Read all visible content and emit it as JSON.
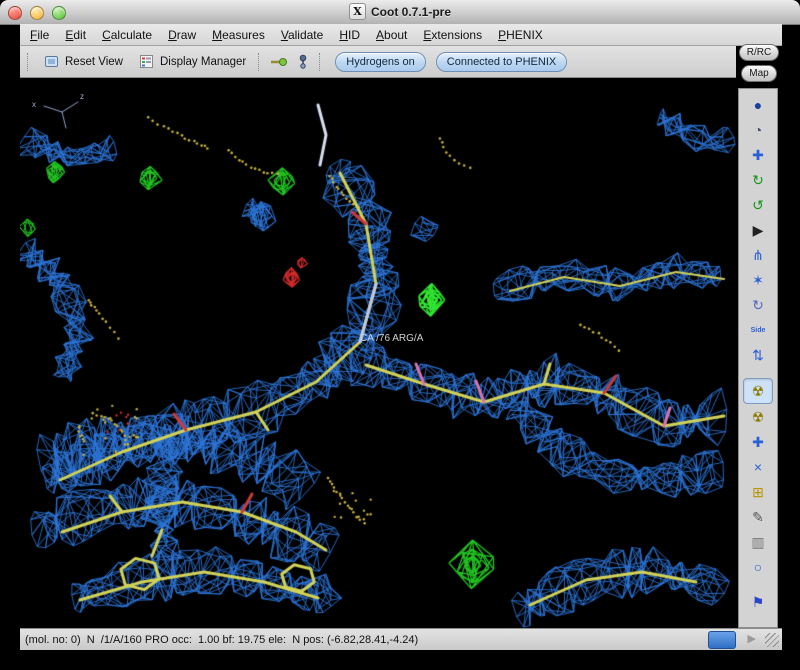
{
  "window": {
    "title": "Coot 0.7.1-pre",
    "icon_glyph": "X"
  },
  "menu": {
    "items": [
      {
        "label": "File"
      },
      {
        "label": "Edit"
      },
      {
        "label": "Calculate"
      },
      {
        "label": "Draw"
      },
      {
        "label": "Measures"
      },
      {
        "label": "Validate"
      },
      {
        "label": "HID"
      },
      {
        "label": "About"
      },
      {
        "label": "Extensions"
      },
      {
        "label": "PHENIX"
      }
    ]
  },
  "toolbar": {
    "reset_view": "Reset View",
    "display_manager": "Display Manager",
    "hydrogens_toggle": "Hydrogens on",
    "phenix_toggle": "Connected to PHENIX"
  },
  "right_rail": {
    "rrc": "R/RC",
    "map": "Map",
    "icons": [
      {
        "name": "sphere-icon",
        "glyph": "●",
        "color": "#1c3f9c"
      },
      {
        "name": "recentre-icon",
        "glyph": "◔",
        "color": "#44506a"
      },
      {
        "name": "move-zone-icon",
        "glyph": "✚",
        "color": "#2b5fd9"
      },
      {
        "name": "refine-zone-icon",
        "glyph": "↻",
        "color": "#149414"
      },
      {
        "name": "regularize-zone-icon",
        "glyph": "↺",
        "color": "#149414"
      },
      {
        "name": "pointer-icon",
        "glyph": "▶",
        "color": "#222222"
      },
      {
        "name": "auto-fit-rotamer-icon",
        "glyph": "⋔",
        "color": "#2b5fd9"
      },
      {
        "name": "rotamers-icon",
        "glyph": "✶",
        "color": "#2b5fd9"
      },
      {
        "name": "edit-chi-angles-icon",
        "glyph": "↻",
        "color": "#5566bb"
      },
      {
        "name": "side-chain-flip-icon",
        "glyph": "Side",
        "color": "#2b5fd9",
        "text": true
      },
      {
        "name": "flip-peptide-icon",
        "glyph": "⇅",
        "color": "#2b5fd9"
      },
      {
        "name": "add-terminal-residue-icon",
        "glyph": "☢",
        "color": "#8a7a00",
        "selected": true,
        "gap_before": true
      },
      {
        "name": "run-refinement-icon",
        "glyph": "☢",
        "color": "#8a7a00"
      },
      {
        "name": "fix-atom-icon",
        "glyph": "✚",
        "color": "#2b5fd9"
      },
      {
        "name": "mutate-icon",
        "glyph": "×",
        "color": "#2b5fd9"
      },
      {
        "name": "add-atom-icon",
        "glyph": "⊞",
        "color": "#b89400"
      },
      {
        "name": "pencil-icon",
        "glyph": "✎",
        "color": "#555555"
      },
      {
        "name": "delete-item-icon",
        "glyph": "▥",
        "color": "#777777"
      },
      {
        "name": "undo-icon",
        "glyph": "○",
        "color": "#2b5fd9"
      },
      {
        "name": "flag-icon",
        "glyph": "⚑",
        "color": "#2b44cc",
        "gap_before": true
      }
    ]
  },
  "canvas": {
    "atom_label": "CA /76 ARG/A",
    "axis_x": "x",
    "axis_z": "z",
    "colors": {
      "background": "#000000",
      "mesh": "#2d76d9",
      "diff_pos": "#22c422",
      "diff_pos_bright": "#30e630",
      "diff_neg": "#cf2b2b",
      "sticks": "#d2d258",
      "white_stick": "#d7dff0",
      "light_bond": "#bcc8e4",
      "oxygen": "#cc3a3a",
      "pink": "#d874b0",
      "waters": "#c9b23e",
      "axis": "#93a3c9",
      "label": "#d2d2d2"
    }
  },
  "statusbar": {
    "text": "(mol. no: 0)  N  /1/A/160 PRO occ:  1.00 bf: 19.75 ele:  N pos: (-6.82,28.41,-4.24)",
    "icons": {
      "play": "▶"
    }
  }
}
